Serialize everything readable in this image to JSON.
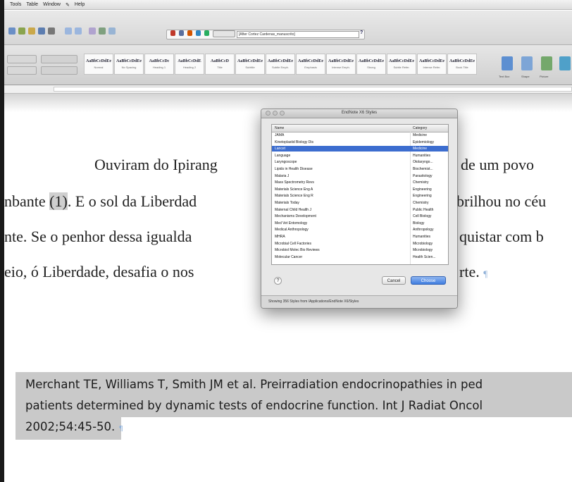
{
  "menubar": {
    "items": [
      "Tools",
      "Table",
      "Window",
      "Help"
    ]
  },
  "toolbar": {
    "style_field_value": "[After Cortez Cardenas_manuscrito]",
    "help_label": "?"
  },
  "ribbon": {
    "styles": [
      {
        "sample": "AaBbCcDdEe",
        "label": "Normal"
      },
      {
        "sample": "AaBbCcDdEe",
        "label": "No Spacing"
      },
      {
        "sample": "AaBbCcDc",
        "label": "Heading 1"
      },
      {
        "sample": "AaBbCcDdE",
        "label": "Heading 2"
      },
      {
        "sample": "AaBbCcD",
        "label": "Title"
      },
      {
        "sample": "AaBbCcDdEe",
        "label": "Subtitle"
      },
      {
        "sample": "AaBbCcDdEe",
        "label": "Subtle Emph."
      },
      {
        "sample": "AaBbCcDdEe",
        "label": "Emphasis"
      },
      {
        "sample": "AaBbCcDdEe",
        "label": "Intense Emph."
      },
      {
        "sample": "AaBbCcDdEe",
        "label": "Strong"
      },
      {
        "sample": "AaBbCcDdEe",
        "label": "Subtle Refer."
      },
      {
        "sample": "AaBbCcDdEe",
        "label": "Intense Refer."
      },
      {
        "sample": "AaBbCcDdEe",
        "label": "Book Title"
      }
    ],
    "right_labels": [
      "Text Box",
      "Shape",
      "Picture"
    ]
  },
  "document": {
    "line1": "Ouviram do Ipirang",
    "line1_tail": "s de um povo",
    "line2_pre": "nbante ",
    "line2_ref": "(1)",
    "line2_post": ". E o sol da Liberdad",
    "line2_tail": "brilhou no céu",
    "line3": "nte. Se o penhor dessa igualda",
    "line3_tail": "quistar com b",
    "line4": "eio, ó Liberdade, desafia o nos",
    "line4_tail": "rte.",
    "para_mark": "¶"
  },
  "bibliography": {
    "line1": "Merchant TE, Williams T, Smith JM et al. Preirradiation endocrinopathies in ped",
    "line2": "patients determined by dynamic tests of endocrine function. Int J Radiat Oncol",
    "line3": "2002;54:45-50.",
    "para_mark": "¶"
  },
  "dialog": {
    "title": "EndNote X6 Styles",
    "header_name": "Name",
    "header_category": "Category",
    "rows": [
      {
        "name": "JAMA",
        "category": "Medicine"
      },
      {
        "name": "Kinetoplastid Biology Dis",
        "category": "Epidemiology"
      },
      {
        "name": "Lancet",
        "category": "Medicine"
      },
      {
        "name": "Language",
        "category": "Humanities"
      },
      {
        "name": "Laryngoscope",
        "category": "Otolaryngo..."
      },
      {
        "name": "Lipids in Health Disease",
        "category": "Biochemist..."
      },
      {
        "name": "Malaria J",
        "category": "Parasitology"
      },
      {
        "name": "Mass Spectrometry Revs",
        "category": "Chemistry"
      },
      {
        "name": "Materials Science Eng A",
        "category": "Engineering"
      },
      {
        "name": "Materials Science Eng R",
        "category": "Engineering"
      },
      {
        "name": "Materials Today",
        "category": "Chemistry"
      },
      {
        "name": "Maternal Child Health J",
        "category": "Public Health"
      },
      {
        "name": "Mechanisms Development",
        "category": "Cell Biology"
      },
      {
        "name": "Med Vet Entomology",
        "category": "Biology"
      },
      {
        "name": "Medical Anthropology",
        "category": "Anthropology"
      },
      {
        "name": "MHRA",
        "category": "Humanities"
      },
      {
        "name": "Microbial Cell Factories",
        "category": "Microbiology"
      },
      {
        "name": "Microbiol Molec Bio Reviews",
        "category": "Microbiology"
      },
      {
        "name": "Molecular Cancer",
        "category": "Health Scien..."
      }
    ],
    "selected_index": 2,
    "help_label": "?",
    "cancel_label": "Cancel",
    "choose_label": "Choose",
    "status_text": "Showing 356 Styles from /Applications/EndNote X6/Styles"
  },
  "colors": {
    "selection": "#3c6dcf",
    "choose_button": "#3f7de0",
    "highlight": "#c9c9c9",
    "paragraph_mark": "#8fb0d8"
  }
}
